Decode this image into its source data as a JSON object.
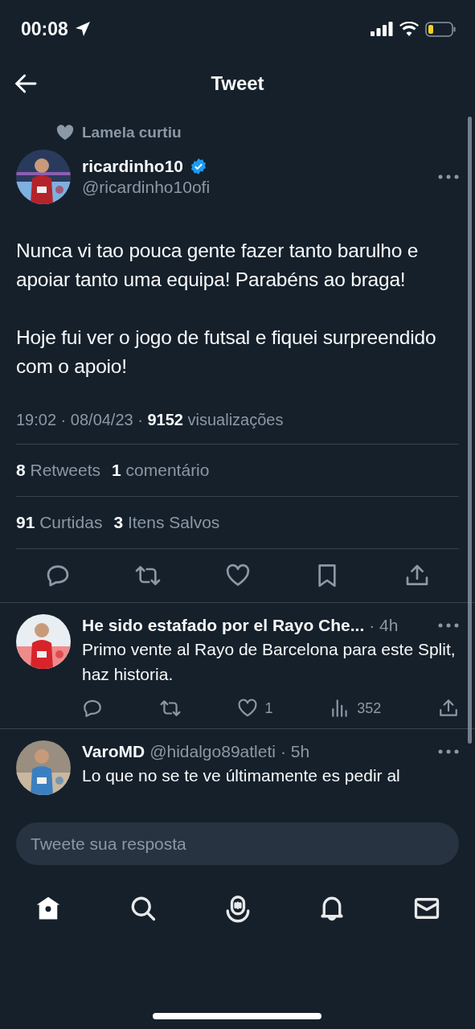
{
  "status_bar": {
    "time": "00:08"
  },
  "header": {
    "title": "Tweet"
  },
  "tweet": {
    "social_context": "Lamela curtiu",
    "author": {
      "name": "ricardinho10",
      "handle": "@ricardinho10ofi",
      "verified": true
    },
    "paragraphs": [
      "Nunca vi tao pouca gente fazer tanto barulho e apoiar tanto uma equipa! Parabéns ao braga!",
      "Hoje fui ver o jogo de futsal e fiquei surpreendido com o apoio!"
    ],
    "meta": "19:02 · 08/04/23 · **9152** visualizações",
    "stat_rows": [
      [
        "**8** Retweets",
        "**1** comentário"
      ],
      [
        "**91** Curtidas",
        "**3** Itens Salvos"
      ]
    ]
  },
  "replies": [
    {
      "name": "He sido estafado por el Rayo Che...",
      "time": "· 4h",
      "text": "Primo vente al Rayo de Barcelona para este Split, haz historia.",
      "likes": "1",
      "views": "352"
    },
    {
      "name": "VaroMD",
      "handle": "@hidalgo89atleti",
      "time": "· 5h",
      "text": "Lo que no se te ve últimamente es pedir al"
    }
  ],
  "reply_box": {
    "placeholder": "Tweete sua resposta"
  },
  "nav": [
    {
      "kind": "home",
      "selected": true
    },
    {
      "kind": "search",
      "selected": false
    },
    {
      "kind": "spaces",
      "selected": false
    },
    {
      "kind": "notifications",
      "selected": false
    },
    {
      "kind": "messages",
      "selected": false
    }
  ]
}
